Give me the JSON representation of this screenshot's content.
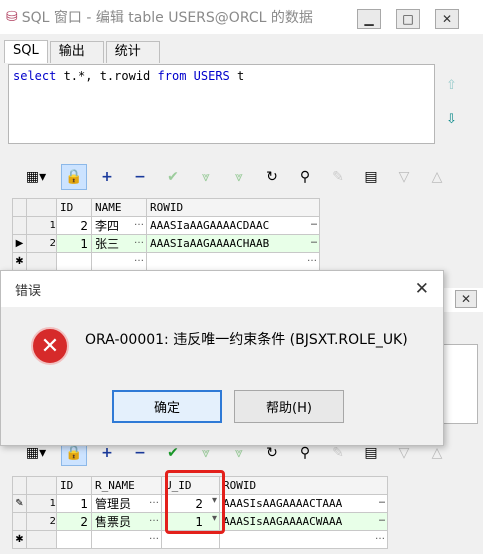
{
  "win1": {
    "title": "SQL 窗口 - 编辑 table USERS@ORCL 的数据",
    "tabs": [
      "SQL",
      "输出",
      "统计"
    ],
    "sql_keyword1": "select",
    "sql_mid1": " t.*, t.rowid ",
    "sql_keyword2": "from",
    "sql_mid2": " USERS ",
    "sql_alias": "t",
    "grid": {
      "headers": [
        "ID",
        "NAME",
        "ROWID"
      ],
      "rows": [
        {
          "rownum": "1",
          "id": "2",
          "name": "李四",
          "rowid": "AAASIaAAGAAAACDAAC"
        },
        {
          "rownum": "2",
          "id": "1",
          "name": "张三",
          "rowid": "AAASIaAAGAAAACHAAB"
        }
      ],
      "new_row_marker": "✱"
    }
  },
  "win2": {
    "grid": {
      "headers": [
        "ID",
        "R_NAME",
        "U_ID",
        "ROWID"
      ],
      "rows": [
        {
          "rownum": "1",
          "id": "1",
          "name": "管理员",
          "uid": "2",
          "rowid": "AAASIsAAGAAAACTAAA"
        },
        {
          "rownum": "2",
          "id": "2",
          "name": "售票员",
          "uid": "1",
          "rowid": "AAASIsAAGAAAACWAAA"
        }
      ],
      "new_row_marker": "✱"
    }
  },
  "dialog": {
    "title": "错误",
    "message": "ORA-00001: 违反唯一约束条件 (BJSXT.ROLE_UK)",
    "ok_label": "确定",
    "help_label": "帮助(H)"
  },
  "colors": {
    "accent": "#2f7ad6",
    "error": "#d62a2a",
    "highlight": "#e3201b",
    "alt_row": "#e8ffe8"
  }
}
